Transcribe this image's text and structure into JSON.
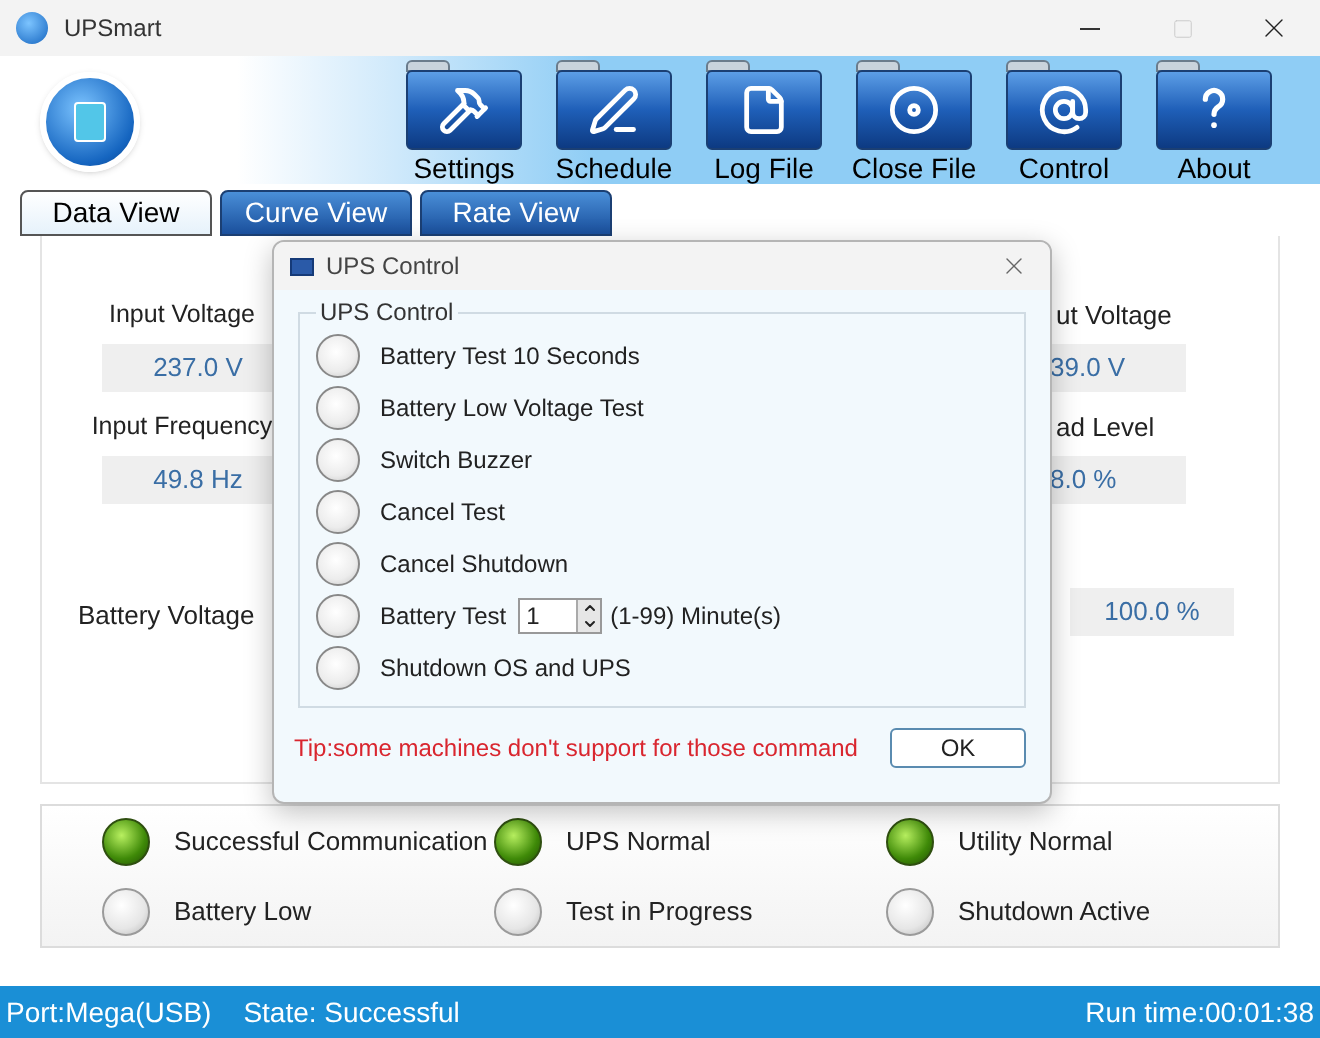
{
  "window": {
    "title": "UPSmart"
  },
  "toolbar": [
    {
      "label": "Settings",
      "kind": "hammer"
    },
    {
      "label": "Schedule",
      "kind": "pen"
    },
    {
      "label": "Log File",
      "kind": "document"
    },
    {
      "label": "Close File",
      "kind": "disc"
    },
    {
      "label": "Control",
      "kind": "at"
    },
    {
      "label": "About",
      "kind": "help"
    }
  ],
  "tabs": [
    {
      "label": "Data View",
      "selected": true
    },
    {
      "label": "Curve View",
      "selected": false
    },
    {
      "label": "Rate View",
      "selected": false
    }
  ],
  "readings_left": [
    {
      "label": "Input Voltage",
      "value": "237.0 V"
    },
    {
      "label": "Input Frequency",
      "value": "49.8 Hz"
    }
  ],
  "battery_voltage_label": "Battery Voltage",
  "readings_right": [
    {
      "label": "ut Voltage",
      "value": "39.0 V"
    },
    {
      "label": "ad Level",
      "value": "8.0 %"
    }
  ],
  "battery_capacity_value": "100.0 %",
  "indicators": [
    {
      "label": "Successful Communication",
      "on": true
    },
    {
      "label": "UPS Normal",
      "on": true
    },
    {
      "label": "Utility Normal",
      "on": true
    },
    {
      "label": "Battery Low",
      "on": false
    },
    {
      "label": "Test in Progress",
      "on": false
    },
    {
      "label": "Shutdown Active",
      "on": false
    }
  ],
  "status_bar": {
    "port": "Port:Mega(USB)",
    "state": "State: Successful",
    "run_time": "Run time:00:01:38"
  },
  "dialog": {
    "title": "UPS Control",
    "group_title": "UPS Control",
    "options": [
      {
        "kind": "radio",
        "label": "Battery Test 10 Seconds",
        "selected": false
      },
      {
        "kind": "radio",
        "label": "Battery Low Voltage Test",
        "selected": false
      },
      {
        "kind": "radio",
        "label": "Switch Buzzer",
        "selected": false
      },
      {
        "kind": "radio",
        "label": "Cancel Test",
        "selected": false
      },
      {
        "kind": "radio",
        "label": "Cancel Shutdown",
        "selected": false
      },
      {
        "kind": "spinner",
        "label": "Battery Test",
        "value": "1",
        "suffix": "(1-99) Minute(s)",
        "selected": false
      },
      {
        "kind": "radio",
        "label": "Shutdown OS and UPS",
        "selected": false
      }
    ],
    "tip": "Tip:some machines don't support for those command",
    "ok_button": "OK"
  }
}
